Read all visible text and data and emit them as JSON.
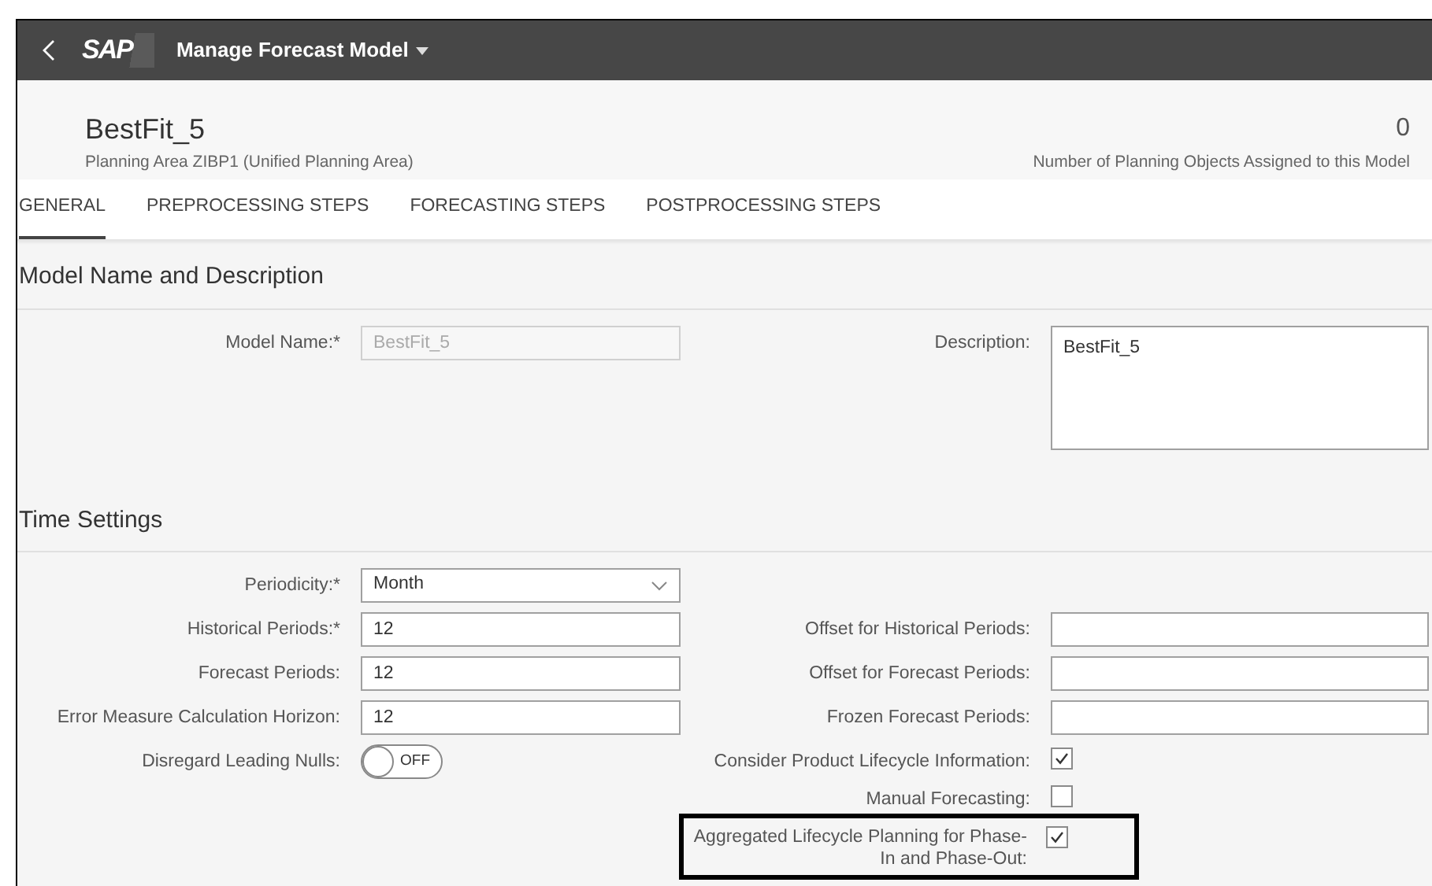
{
  "shell_bar": {
    "logo": "SAP",
    "title": "Manage Forecast Model"
  },
  "header": {
    "title": "BestFit_5",
    "subtitle": "Planning Area ZIBP1 (Unified Planning Area)",
    "count": "0",
    "count_label": "Number of Planning Objects Assigned to this Model"
  },
  "tabs": [
    {
      "label": "GENERAL",
      "selected": true
    },
    {
      "label": "PREPROCESSING STEPS",
      "selected": false
    },
    {
      "label": "FORECASTING STEPS",
      "selected": false
    },
    {
      "label": "POSTPROCESSING STEPS",
      "selected": false
    }
  ],
  "sections": [
    {
      "title": "Model Name and Description",
      "left": [
        {
          "kind": "input",
          "label": "Model Name:*",
          "value": "BestFit_5",
          "disabled": true
        }
      ],
      "right": [
        {
          "kind": "textarea",
          "label": "Description:",
          "value": "BestFit_5"
        }
      ]
    },
    {
      "title": "Time Settings",
      "left": [
        {
          "kind": "select",
          "label": "Periodicity:*",
          "value": "Month"
        },
        {
          "kind": "input",
          "label": "Historical Periods:*",
          "value": "12",
          "disabled": false
        },
        {
          "kind": "input",
          "label": "Forecast Periods:",
          "value": "12",
          "disabled": false
        },
        {
          "kind": "input",
          "label": "Error Measure Calculation Horizon:",
          "value": "12",
          "disabled": false
        },
        {
          "kind": "toggle",
          "label": "Disregard Leading Nulls:",
          "on": false,
          "state_text": "OFF"
        }
      ],
      "right": [
        {
          "kind": "spacer"
        },
        {
          "kind": "input",
          "label": "Offset for Historical Periods:",
          "disabled": false
        },
        {
          "kind": "input",
          "label": "Offset for Forecast Periods:",
          "disabled": false
        },
        {
          "kind": "input",
          "label": "Frozen Forecast Periods:",
          "disabled": false
        },
        {
          "kind": "checkbox",
          "label": "Consider Product Lifecycle Information:",
          "checked": true,
          "highlighted": false
        },
        {
          "kind": "checkbox",
          "label": "Manual Forecasting:",
          "checked": false,
          "highlighted": false
        },
        {
          "kind": "checkbox",
          "label": "Aggregated Lifecycle Planning for Phase-In and Phase-Out:",
          "checked": true,
          "highlighted": true
        }
      ]
    }
  ]
}
